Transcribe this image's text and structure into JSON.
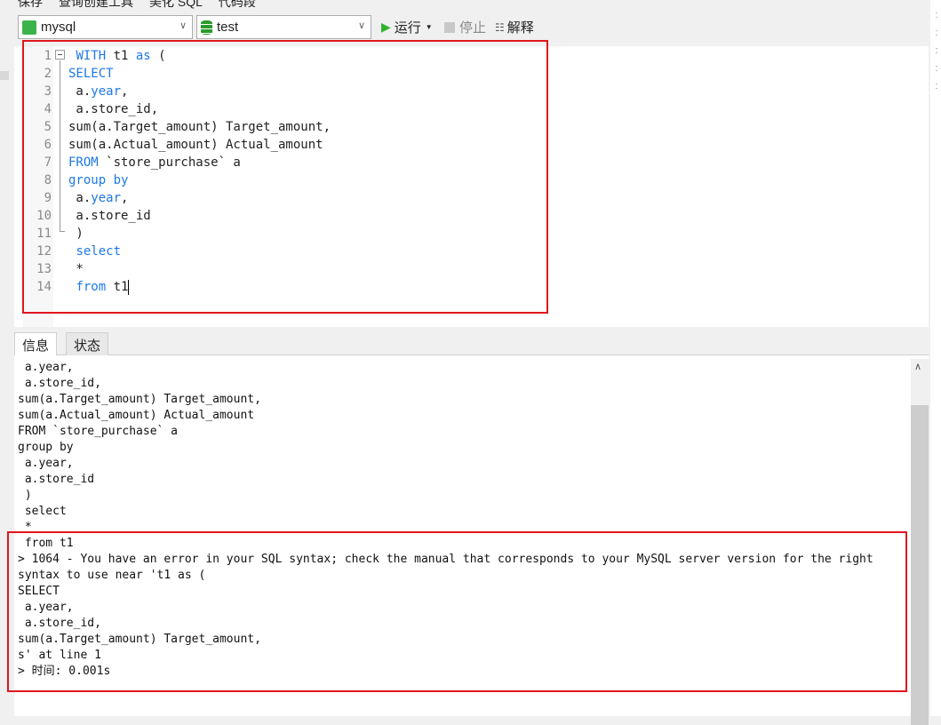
{
  "toolbar_top": {
    "items": [
      "保存",
      "查询创建工具",
      "美化 SQL",
      "代码段"
    ]
  },
  "connection": {
    "value": "mysql"
  },
  "database": {
    "value": "test"
  },
  "actions": {
    "run": "运行",
    "stop": "停止",
    "explain": "解释"
  },
  "colors": {
    "keyword": "#1e78e6",
    "highlight_box": "#e0161e",
    "run_icon": "#2db32d"
  },
  "editor": {
    "lines": [
      [
        {
          "t": " "
        },
        {
          "t": "WITH",
          "k": 1
        },
        {
          "t": " t1 "
        },
        {
          "t": "as",
          "k": 1
        },
        {
          "t": " ("
        }
      ],
      [
        {
          "t": "SELECT",
          "k": 1
        }
      ],
      [
        {
          "t": " a."
        },
        {
          "t": "year",
          "k": 1
        },
        {
          "t": ","
        }
      ],
      [
        {
          "t": " a.store_id,"
        }
      ],
      [
        {
          "t": "sum(a.Target_amount) Target_amount,"
        }
      ],
      [
        {
          "t": "sum(a.Actual_amount) Actual_amount"
        }
      ],
      [
        {
          "t": "FROM",
          "k": 1
        },
        {
          "t": " `store_purchase` a"
        }
      ],
      [
        {
          "t": "group by",
          "k": 1
        }
      ],
      [
        {
          "t": " a."
        },
        {
          "t": "year",
          "k": 1
        },
        {
          "t": ","
        }
      ],
      [
        {
          "t": " a.store_id"
        }
      ],
      [
        {
          "t": " )"
        }
      ],
      [
        {
          "t": " "
        },
        {
          "t": "select",
          "k": 1
        }
      ],
      [
        {
          "t": " *"
        }
      ],
      [
        {
          "t": " "
        },
        {
          "t": "from",
          "k": 1
        },
        {
          "t": " t1"
        }
      ]
    ]
  },
  "tabs": [
    "信息",
    "状态"
  ],
  "output": {
    "lines": [
      " a.year,",
      " a.store_id,",
      "sum(a.Target_amount) Target_amount,",
      "sum(a.Actual_amount) Actual_amount",
      "FROM `store_purchase` a",
      "group by",
      " a.year,",
      " a.store_id",
      " )",
      " select",
      " *",
      " from t1",
      "> 1064 - You have an error in your SQL syntax; check the manual that corresponds to your MySQL server version for the right",
      "syntax to use near 't1 as (",
      "SELECT",
      " a.year,",
      " a.store_id,",
      "sum(a.Target_amount) Target_amount,",
      "s' at line 1",
      "> 时间: 0.001s"
    ]
  }
}
